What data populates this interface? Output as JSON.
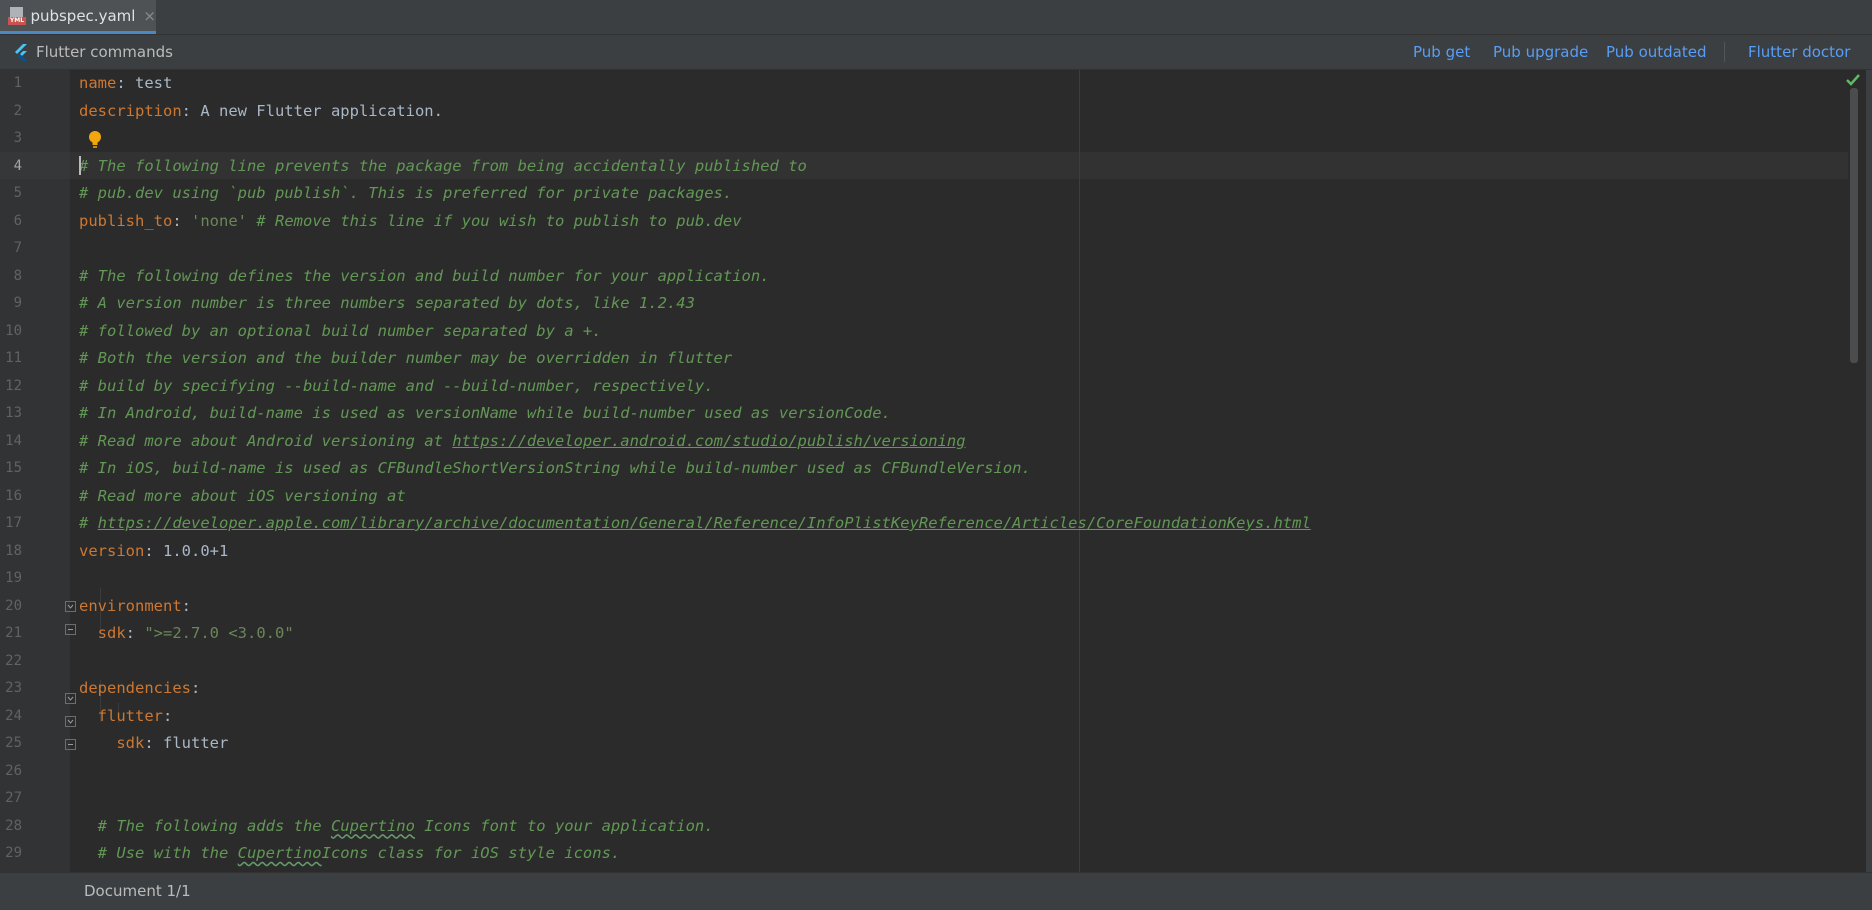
{
  "tab": {
    "file_name": "pubspec.yaml",
    "icon_text": "YML",
    "close_glyph": "×"
  },
  "command_bar": {
    "title": "Flutter commands",
    "actions": [
      "Pub get",
      "Pub upgrade",
      "Pub outdated",
      "Flutter doctor"
    ]
  },
  "editor": {
    "current_line": 4,
    "lines": [
      {
        "n": "1",
        "tokens": [
          {
            "t": "name",
            "c": "k"
          },
          {
            "t": ": ",
            "c": "v"
          },
          {
            "t": "test",
            "c": "v"
          }
        ]
      },
      {
        "n": "2",
        "tokens": [
          {
            "t": "description",
            "c": "k"
          },
          {
            "t": ": A new Flutter application.",
            "c": "v"
          }
        ]
      },
      {
        "n": "3",
        "tokens": []
      },
      {
        "n": "4",
        "tokens": [
          {
            "t": "# The following line prevents the package from being accidentally published to",
            "c": "c"
          }
        ]
      },
      {
        "n": "5",
        "tokens": [
          {
            "t": "# pub.dev using `pub publish`. This is preferred for private packages.",
            "c": "c"
          }
        ]
      },
      {
        "n": "6",
        "tokens": [
          {
            "t": "publish_to",
            "c": "k"
          },
          {
            "t": ": ",
            "c": "v"
          },
          {
            "t": "'none'",
            "c": "s"
          },
          {
            "t": " # Remove this line if you wish to publish to pub.dev",
            "c": "c"
          }
        ]
      },
      {
        "n": "7",
        "tokens": []
      },
      {
        "n": "8",
        "tokens": [
          {
            "t": "# The following defines the version and build number for your application.",
            "c": "c"
          }
        ]
      },
      {
        "n": "9",
        "tokens": [
          {
            "t": "# A version number is three numbers separated by dots, like 1.2.43",
            "c": "c"
          }
        ]
      },
      {
        "n": "10",
        "tokens": [
          {
            "t": "# followed by an optional build number separated by a +.",
            "c": "c"
          }
        ]
      },
      {
        "n": "11",
        "tokens": [
          {
            "t": "# Both the version and the builder number may be overridden in flutter",
            "c": "c"
          }
        ]
      },
      {
        "n": "12",
        "tokens": [
          {
            "t": "# build by specifying --build-name and --build-number, respectively.",
            "c": "c"
          }
        ]
      },
      {
        "n": "13",
        "tokens": [
          {
            "t": "# In Android, build-name is used as versionName while build-number used as versionCode.",
            "c": "c"
          }
        ]
      },
      {
        "n": "14",
        "tokens": [
          {
            "t": "# Read more about Android versioning at ",
            "c": "c"
          },
          {
            "t": "https://developer.android.com/studio/publish/versioning",
            "c": "c u"
          }
        ]
      },
      {
        "n": "15",
        "tokens": [
          {
            "t": "# In iOS, build-name is used as CFBundleShortVersionString while build-number used as CFBundleVersion.",
            "c": "c"
          }
        ]
      },
      {
        "n": "16",
        "tokens": [
          {
            "t": "# Read more about iOS versioning at",
            "c": "c"
          }
        ]
      },
      {
        "n": "17",
        "tokens": [
          {
            "t": "# ",
            "c": "c"
          },
          {
            "t": "https://developer.apple.com/library/archive/documentation/General/Reference/InfoPlistKeyReference/Articles/CoreFoundationKeys.html",
            "c": "c u"
          }
        ]
      },
      {
        "n": "18",
        "tokens": [
          {
            "t": "version",
            "c": "k"
          },
          {
            "t": ": 1.0.0+1",
            "c": "v"
          }
        ]
      },
      {
        "n": "19",
        "tokens": []
      },
      {
        "n": "20",
        "tokens": [
          {
            "t": "environment",
            "c": "k"
          },
          {
            "t": ":",
            "c": "v"
          }
        ]
      },
      {
        "n": "21",
        "tokens": [
          {
            "t": "  ",
            "c": "v"
          },
          {
            "t": "sdk",
            "c": "k"
          },
          {
            "t": ": ",
            "c": "v"
          },
          {
            "t": "\">=2.7.0 <3.0.0\"",
            "c": "s"
          }
        ]
      },
      {
        "n": "22",
        "tokens": []
      },
      {
        "n": "23",
        "tokens": [
          {
            "t": "dependencies",
            "c": "k"
          },
          {
            "t": ":",
            "c": "v"
          }
        ]
      },
      {
        "n": "24",
        "tokens": [
          {
            "t": "  ",
            "c": "v"
          },
          {
            "t": "flutter",
            "c": "k"
          },
          {
            "t": ":",
            "c": "v"
          }
        ]
      },
      {
        "n": "25",
        "tokens": [
          {
            "t": "    ",
            "c": "v"
          },
          {
            "t": "sdk",
            "c": "k"
          },
          {
            "t": ": flutter",
            "c": "v"
          }
        ]
      },
      {
        "n": "26",
        "tokens": []
      },
      {
        "n": "27",
        "tokens": []
      },
      {
        "n": "28",
        "tokens": [
          {
            "t": "  # The following adds the ",
            "c": "c"
          },
          {
            "t": "Cupertino",
            "c": "c typo"
          },
          {
            "t": " Icons font to your application.",
            "c": "c"
          }
        ]
      },
      {
        "n": "29",
        "tokens": [
          {
            "t": "  # Use with the ",
            "c": "c"
          },
          {
            "t": "Cupertino",
            "c": "c typo"
          },
          {
            "t": "Icons class for iOS style icons.",
            "c": "c"
          }
        ]
      }
    ]
  },
  "status_bar": {
    "text": "Document 1/1"
  },
  "colors": {
    "background": "#2b2b2b",
    "keyword": "#cc7832",
    "comment": "#629755",
    "string": "#6a8759",
    "link": "#589df6"
  }
}
